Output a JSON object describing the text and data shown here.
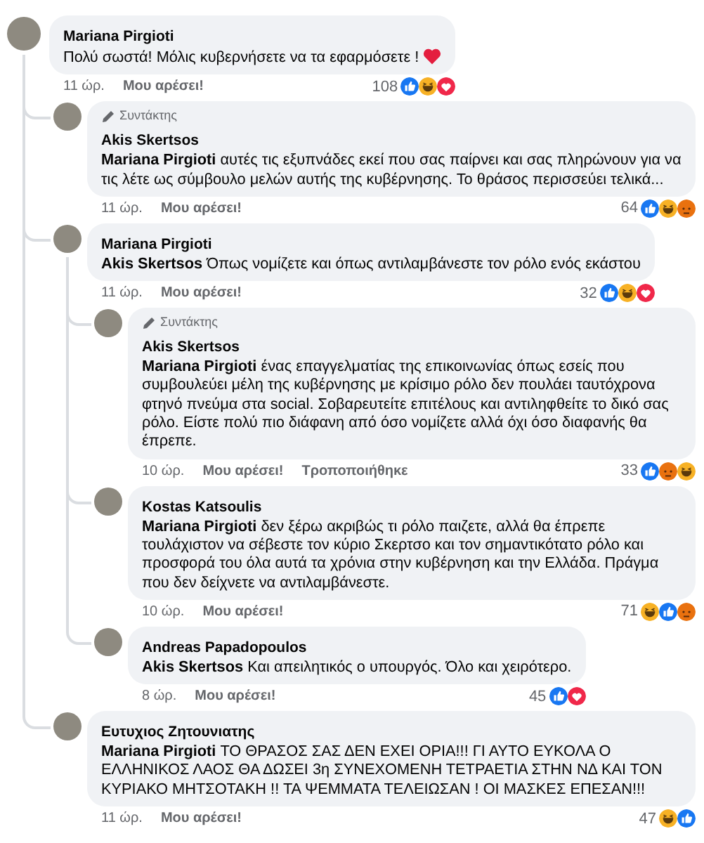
{
  "comments": [
    {
      "author": "Mariana Pirgioti",
      "body": "Πολύ σωστά! Μόλις κυβερνήσετε να τα εφαρμόσετε !",
      "heart": true,
      "time": "11 ώρ.",
      "like_label": "Μου αρέσει!",
      "reaction_count": "108",
      "reactions": [
        {
          "kind": "like"
        },
        {
          "kind": "haha"
        },
        {
          "kind": "love"
        }
      ],
      "replies": [
        {
          "author": "Akis Skertsos",
          "badge": "Συντάκτης",
          "body": "**Mariana Pirgioti** αυτές τις εξυπνάδες εκεί που σας παίρνει και σας πληρώνουν για να τις λέτε ως σύμβουλο μελών αυτής της κυβέρνησης. Το θράσος περισσεύει τελικά...",
          "time": "11 ώρ.",
          "like_label": "Μου αρέσει!",
          "reaction_count": "64",
          "reactions": [
            {
              "kind": "like"
            },
            {
              "kind": "haha"
            },
            {
              "kind": "angry"
            }
          ]
        },
        {
          "author": "Mariana Pirgioti",
          "body": "**Akis Skertsos** Όπως νομίζετε και όπως αντιλαμβάνεστε τον ρόλο ενός εκάστου",
          "time": "11 ώρ.",
          "like_label": "Μου αρέσει!",
          "reaction_count": "32",
          "reactions": [
            {
              "kind": "like"
            },
            {
              "kind": "haha"
            },
            {
              "kind": "love"
            }
          ],
          "replies": [
            {
              "author": "Akis Skertsos",
              "badge": "Συντάκτης",
              "body": "**Mariana Pirgioti** ένας επαγγελματίας της επικοινωνίας όπως εσείς που συμβουλεύει μέλη της κυβέρνησης με κρίσιμο ρόλο δεν πουλάει ταυτόχρονα φτηνό πνεύμα στα social. Σοβαρευτείτε επιτέλους και αντιληφθείτε το δικό σας ρόλο. Είστε πολύ πιο διάφανη από όσο νομίζετε αλλά όχι όσο διαφανής θα έπρεπε.",
              "time": "10 ώρ.",
              "like_label": "Μου αρέσει!",
              "edited": "Τροποποιήθηκε",
              "reaction_count": "33",
              "reactions": [
                {
                  "kind": "like"
                },
                {
                  "kind": "angry"
                },
                {
                  "kind": "haha"
                }
              ]
            },
            {
              "author": "Kostas Katsoulis",
              "body": "**Mariana Pirgioti** δεν ξέρω ακριβώς τι ρόλο παιζετε, αλλά θα έπρεπε τουλάχιστον να σέβεστε τον κύριο Σκερτσο και τον σημαντικότατο ρόλο και προσφορά του όλα αυτά τα χρόνια στην κυβέρνηση και την Ελλάδα. Πράγμα που δεν δείχνετε να αντιλαμβάνεστε.",
              "time": "10 ώρ.",
              "like_label": "Μου αρέσει!",
              "reaction_count": "71",
              "reactions": [
                {
                  "kind": "haha"
                },
                {
                  "kind": "like"
                },
                {
                  "kind": "angry"
                }
              ]
            },
            {
              "author": "Andreas Papadopoulos",
              "body": "**Akis Skertsos** Και απειλητικός ο υπουργός. Όλο και χειρότερο.",
              "time": "8 ώρ.",
              "like_label": "Μου αρέσει!",
              "reaction_count": "45",
              "reactions": [
                {
                  "kind": "like"
                },
                {
                  "kind": "love"
                }
              ]
            }
          ]
        },
        {
          "author": "Ευτυχιος Ζητουνιατης",
          "body": "**Mariana Pirgioti** ΤΟ ΘΡΑΣΟΣ ΣΑΣ ΔΕΝ ΕΧΕΙ ΟΡΙΑ!!! ΓΙ ΑΥΤΟ ΕΥΚΟΛΑ Ο ΕΛΛΗΝΙΚΟΣ ΛΑΟΣ ΘΑ ΔΩΣΕΙ 3η ΣΥΝΕΧΟΜΕΝΗ ΤΕΤΡΑΕΤΙΑ ΣΤΗΝ ΝΔ ΚΑΙ ΤΟΝ ΚΥΡΙΑΚΟ ΜΗΤΣΟΤΑΚΗ !! ΤΑ ΨΕΜΜΑΤΑ ΤΕΛΕΙΩΣΑΝ ! ΟΙ ΜΑΣΚΕΣ ΕΠΕΣΑΝ!!!",
          "time": "11 ώρ.",
          "like_label": "Μου αρέσει!",
          "reaction_count": "47",
          "reactions": [
            {
              "kind": "haha"
            },
            {
              "kind": "like"
            }
          ]
        }
      ]
    }
  ]
}
